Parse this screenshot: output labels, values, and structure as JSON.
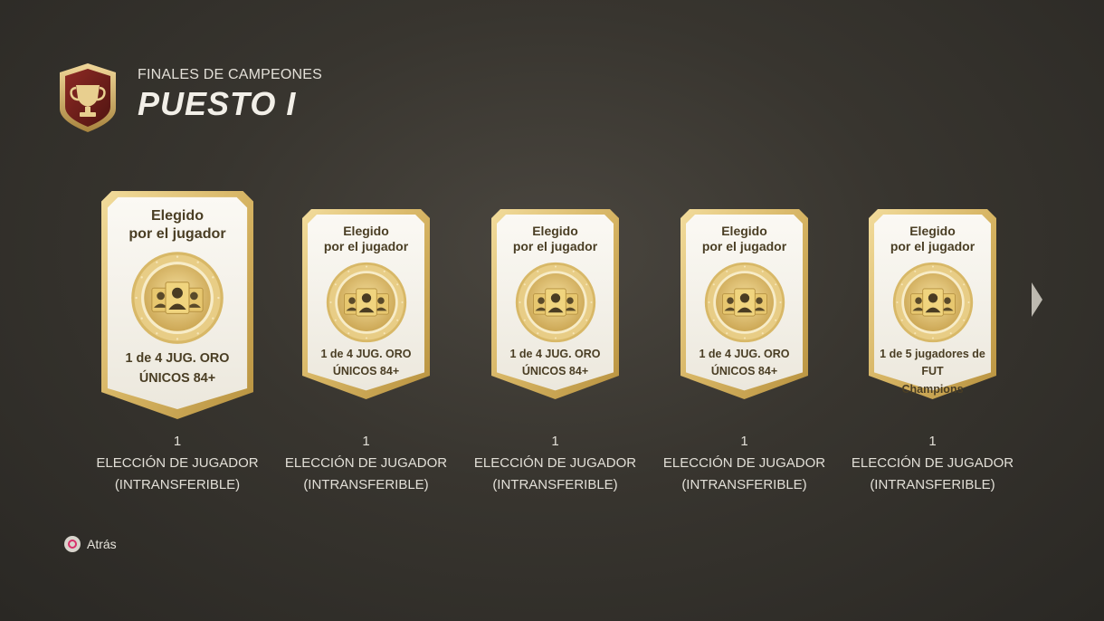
{
  "header": {
    "subtitle": "FINALES DE CAMPEONES",
    "title": "PUESTO I"
  },
  "cards": [
    {
      "title_line1": "Elegido",
      "title_line2": "por el jugador",
      "desc_line1": "1 de 4 JUG. ORO",
      "desc_line2": "ÚNICOS 84+",
      "count": "1",
      "caption_line1": "ELECCIÓN DE JUGADOR",
      "caption_line2": "(INTRANSFERIBLE)",
      "selected": true
    },
    {
      "title_line1": "Elegido",
      "title_line2": "por el jugador",
      "desc_line1": "1 de 4 JUG. ORO",
      "desc_line2": "ÚNICOS 84+",
      "count": "1",
      "caption_line1": "ELECCIÓN DE JUGADOR",
      "caption_line2": "(INTRANSFERIBLE)",
      "selected": false
    },
    {
      "title_line1": "Elegido",
      "title_line2": "por el jugador",
      "desc_line1": "1 de 4 JUG. ORO",
      "desc_line2": "ÚNICOS 84+",
      "count": "1",
      "caption_line1": "ELECCIÓN DE JUGADOR",
      "caption_line2": "(INTRANSFERIBLE)",
      "selected": false
    },
    {
      "title_line1": "Elegido",
      "title_line2": "por el jugador",
      "desc_line1": "1 de 4 JUG. ORO",
      "desc_line2": "ÚNICOS 84+",
      "count": "1",
      "caption_line1": "ELECCIÓN DE JUGADOR",
      "caption_line2": "(INTRANSFERIBLE)",
      "selected": false
    },
    {
      "title_line1": "Elegido",
      "title_line2": "por el jugador",
      "desc_line1": "1 de 5 jugadores de FUT",
      "desc_line2": "Champions",
      "count": "1",
      "caption_line1": "ELECCIÓN DE JUGADOR",
      "caption_line2": "(INTRANSFERIBLE)",
      "selected": false
    }
  ],
  "footer": {
    "back_label": "Atrás",
    "back_icon": "circle-button-icon"
  },
  "navigation": {
    "next_icon": "chevron-right-icon"
  },
  "colors": {
    "card_gold": "#d9b86a",
    "card_white": "#f4f1e9",
    "badge_red": "#7a1f1c"
  }
}
